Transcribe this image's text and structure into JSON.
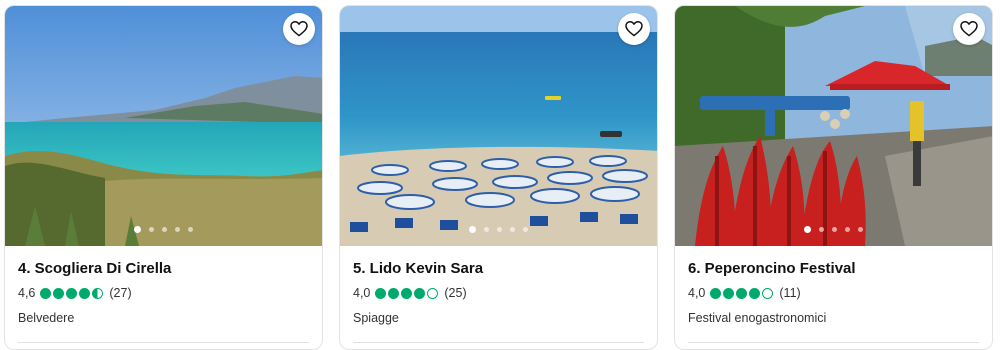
{
  "cards": [
    {
      "title": "4. Scogliera Di Cirella",
      "rating": "4,6",
      "bubbles": [
        "full",
        "full",
        "full",
        "full",
        "half"
      ],
      "reviews": "(27)",
      "category": "Belvedere",
      "favorite_icon": "heart-outline-icon",
      "photo_count": 5,
      "active_photo": 1
    },
    {
      "title": "5. Lido Kevin Sara",
      "rating": "4,0",
      "bubbles": [
        "full",
        "full",
        "full",
        "full",
        "empty"
      ],
      "reviews": "(25)",
      "category": "Spiagge",
      "favorite_icon": "heart-outline-icon",
      "photo_count": 5,
      "active_photo": 1
    },
    {
      "title": "6. Peperoncino Festival",
      "rating": "4,0",
      "bubbles": [
        "full",
        "full",
        "full",
        "full",
        "empty"
      ],
      "reviews": "(11)",
      "category": "Festival enogastronomici",
      "favorite_icon": "heart-outline-icon",
      "photo_count": 5,
      "active_photo": 1
    }
  ],
  "colors": {
    "rating_green": "#00aa6c",
    "text": "#1a1a1a"
  }
}
